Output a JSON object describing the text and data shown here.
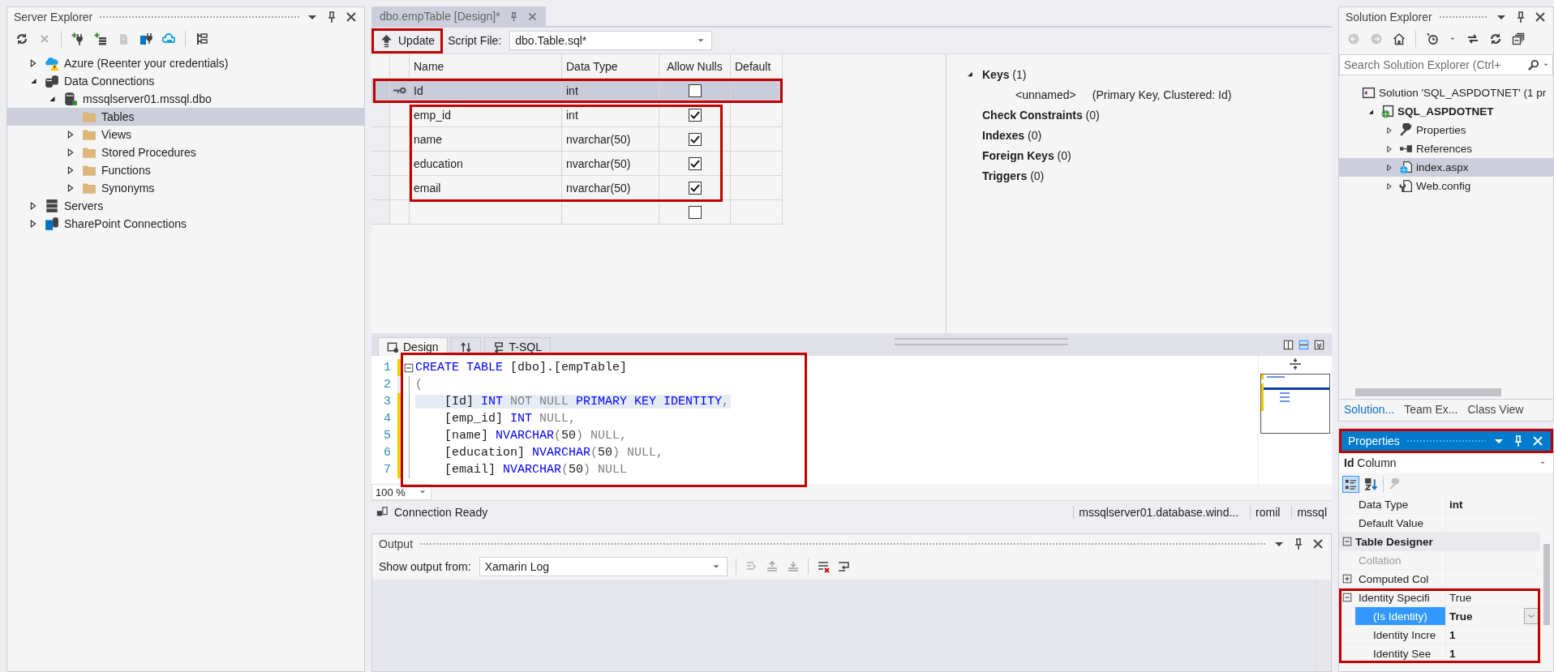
{
  "server_explorer": {
    "title": "Server Explorer",
    "tree": [
      {
        "label": "Azure (Reenter your credentials)",
        "kind": "azure",
        "expanded": false,
        "selected": false
      },
      {
        "label": "Data Connections",
        "kind": "database",
        "expanded": true,
        "selected": false,
        "children": [
          {
            "label": "mssqlserver01.mssql.dbo",
            "kind": "dbserver",
            "expanded": true,
            "selected": false,
            "children": [
              {
                "label": "Tables",
                "kind": "folder",
                "selected": true
              },
              {
                "label": "Views",
                "kind": "folder",
                "expanded": false,
                "selected": false
              },
              {
                "label": "Stored Procedures",
                "kind": "folder",
                "expanded": false,
                "selected": false
              },
              {
                "label": "Functions",
                "kind": "folder",
                "expanded": false,
                "selected": false
              },
              {
                "label": "Synonyms",
                "kind": "folder",
                "expanded": false,
                "selected": false
              }
            ]
          }
        ]
      },
      {
        "label": "Servers",
        "kind": "servers",
        "expanded": false,
        "selected": false
      },
      {
        "label": "SharePoint Connections",
        "kind": "sharepoint",
        "expanded": false,
        "selected": false
      }
    ]
  },
  "document_tab": {
    "title": "dbo.empTable [Design]*",
    "selected": true
  },
  "designer_toolbar": {
    "update": {
      "label": "Update",
      "outlined": true
    },
    "script_file_label": "Script File:",
    "script_file": "dbo.Table.sql*"
  },
  "columns_grid": {
    "columns": [
      "Name",
      "Data Type",
      "Allow Nulls",
      "Default"
    ],
    "rows": [
      {
        "name": "Id",
        "type": "int",
        "allow_nulls": false,
        "primary_key": true,
        "selected": true,
        "outlined": true
      },
      {
        "name": "emp_id",
        "type": "int",
        "allow_nulls": true,
        "primary_key": false,
        "selected": false,
        "outlined": true
      },
      {
        "name": "name",
        "type": "nvarchar(50)",
        "allow_nulls": true,
        "primary_key": false,
        "selected": false,
        "outlined": true
      },
      {
        "name": "education",
        "type": "nvarchar(50)",
        "allow_nulls": true,
        "primary_key": false,
        "selected": false,
        "outlined": true
      },
      {
        "name": "email",
        "type": "nvarchar(50)",
        "allow_nulls": true,
        "primary_key": false,
        "selected": false,
        "outlined": true
      },
      {
        "allow_nulls": false,
        "primary_key": false,
        "selected": false
      }
    ]
  },
  "keys_panel": {
    "sections": [
      {
        "title": "Keys",
        "count": "(1)",
        "expanded": true,
        "items": [
          {
            "name": "<unnamed>",
            "detail": "(Primary Key, Clustered: Id)"
          }
        ]
      },
      {
        "title": "Check Constraints",
        "count": "(0)"
      },
      {
        "title": "Indexes",
        "count": "(0)"
      },
      {
        "title": "Foreign Keys",
        "count": "(0)"
      },
      {
        "title": "Triggers",
        "count": "(0)"
      }
    ]
  },
  "view_tabs": [
    {
      "kind": "design",
      "label": "Design",
      "selected": true
    },
    {
      "kind": "swap",
      "selected": false
    },
    {
      "kind": "tsql",
      "label": "T-SQL",
      "selected": false
    }
  ],
  "code_editor": {
    "outlined": true,
    "lines": [
      {
        "number": "1",
        "changed": true,
        "current": false,
        "fold": true,
        "tokens": [
          {
            "kind": "keyword",
            "text": "CREATE TABLE"
          },
          {
            "kind": "plain",
            "text": " [dbo].[empTable]"
          }
        ]
      },
      {
        "number": "2",
        "changed": false,
        "current": false,
        "tokens": [
          {
            "kind": "gray",
            "text": "("
          }
        ]
      },
      {
        "number": "3",
        "changed": true,
        "current": true,
        "tokens": [
          {
            "kind": "plain",
            "text": "    [Id] "
          },
          {
            "kind": "keyword",
            "text": "INT"
          },
          {
            "kind": "gray",
            "text": " NOT NULL "
          },
          {
            "kind": "keyword",
            "text": "PRIMARY KEY IDENTITY"
          },
          {
            "kind": "gray",
            "text": ","
          }
        ]
      },
      {
        "number": "4",
        "changed": true,
        "current": false,
        "tokens": [
          {
            "kind": "plain",
            "text": "    [emp_id] "
          },
          {
            "kind": "keyword",
            "text": "INT"
          },
          {
            "kind": "gray",
            "text": " NULL,"
          }
        ]
      },
      {
        "number": "5",
        "changed": true,
        "current": false,
        "tokens": [
          {
            "kind": "plain",
            "text": "    [name] "
          },
          {
            "kind": "keyword",
            "text": "NVARCHAR"
          },
          {
            "kind": "gray",
            "text": "("
          },
          {
            "kind": "plain",
            "text": "50"
          },
          {
            "kind": "gray",
            "text": ") NULL,"
          }
        ]
      },
      {
        "number": "6",
        "changed": true,
        "current": false,
        "tokens": [
          {
            "kind": "plain",
            "text": "    [education] "
          },
          {
            "kind": "keyword",
            "text": "NVARCHAR"
          },
          {
            "kind": "gray",
            "text": "("
          },
          {
            "kind": "plain",
            "text": "50"
          },
          {
            "kind": "gray",
            "text": ") NULL,"
          }
        ]
      },
      {
        "number": "7",
        "changed": true,
        "current": false,
        "tokens": [
          {
            "kind": "plain",
            "text": "    [email] "
          },
          {
            "kind": "keyword",
            "text": "NVARCHAR"
          },
          {
            "kind": "gray",
            "text": "("
          },
          {
            "kind": "plain",
            "text": "50"
          },
          {
            "kind": "gray",
            "text": ") NULL"
          }
        ]
      }
    ]
  },
  "zoom": "100 %",
  "status_bar": {
    "message": "Connection Ready",
    "segments": [
      "mssqlserver01.database.wind...",
      "romil",
      "mssql"
    ]
  },
  "output": {
    "title": "Output",
    "show_from_label": "Show output from:",
    "source": "Xamarin Log"
  },
  "solution_explorer": {
    "title": "Solution Explorer",
    "search_placeholder": "Search Solution Explorer (Ctrl+",
    "tree": [
      {
        "label": "Solution 'SQL_ASPDOTNET' (1 pr",
        "kind": "solution",
        "selected": false,
        "children": [
          {
            "label": "SQL_ASPDOTNET",
            "kind": "project",
            "expanded": true,
            "selected": false,
            "children": [
              {
                "label": "Properties",
                "kind": "wrench",
                "expanded": false,
                "selected": false
              },
              {
                "label": "References",
                "kind": "references",
                "expanded": false,
                "selected": false
              },
              {
                "label": "index.aspx",
                "kind": "webpage",
                "expanded": false,
                "selected": true
              },
              {
                "label": "Web.config",
                "kind": "config",
                "expanded": false,
                "selected": false
              }
            ]
          }
        ]
      }
    ]
  },
  "bottom_tabs": [
    {
      "label": "Solution...",
      "selected": true
    },
    {
      "label": "Team Ex...",
      "selected": false
    },
    {
      "label": "Class View",
      "selected": false
    }
  ],
  "properties": {
    "title": "Properties",
    "active": true,
    "outlined": true,
    "object_name": "Id",
    "object_type": "Column",
    "rows": [
      {
        "kind": "property",
        "name": "Data Type",
        "value": "int",
        "modified": true,
        "selected": false
      },
      {
        "kind": "property",
        "name": "Default Value",
        "selected": false
      },
      {
        "kind": "category",
        "name": "Table Designer",
        "expanded": true,
        "children": [
          {
            "kind": "property",
            "name": "Collation",
            "disabled": true,
            "selected": false
          },
          {
            "kind": "property",
            "name": "Computed Col",
            "expanded": false,
            "selected": false
          },
          {
            "kind": "property",
            "name": "Identity Specifi",
            "value": "True",
            "expanded": true,
            "modified": false,
            "selected": false,
            "outlined": true,
            "children": [
              {
                "kind": "property",
                "name": "(Is Identity)",
                "value": "True",
                "modified": true,
                "selected": true
              },
              {
                "kind": "property",
                "name": "Identity Incre",
                "value": "1",
                "modified": true,
                "selected": false
              },
              {
                "kind": "property",
                "name": "Identity See",
                "value": "1",
                "modified": true,
                "selected": false
              }
            ]
          }
        ]
      }
    ]
  }
}
